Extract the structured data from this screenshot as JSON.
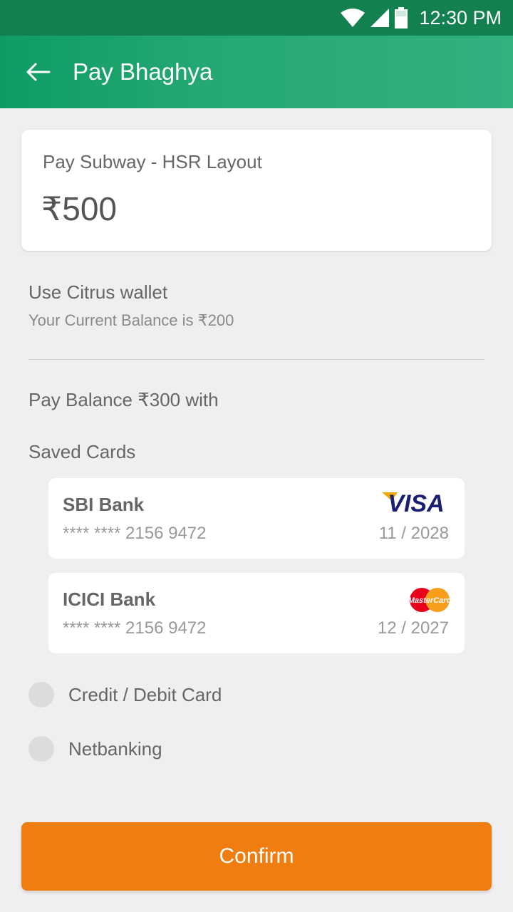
{
  "status_bar": {
    "time": "12:30 PM"
  },
  "app_bar": {
    "title": "Pay Bhaghya"
  },
  "merchant": {
    "name": "Pay Subway - HSR Layout",
    "amount": "₹500"
  },
  "wallet": {
    "title": "Use Citrus wallet",
    "balance_text": "Your Current Balance is ₹200"
  },
  "pay_balance_text": "Pay Balance ₹300 with",
  "saved_cards": {
    "title": "Saved Cards",
    "items": [
      {
        "bank": "SBI Bank",
        "number": "**** **** 2156 9472",
        "expiry": "11 / 2028",
        "brand": "VISA"
      },
      {
        "bank": "ICICI Bank",
        "number": "**** **** 2156 9472",
        "expiry": "12 / 2027",
        "brand": "MasterCard"
      }
    ]
  },
  "options": [
    {
      "label": "Credit / Debit Card",
      "selected": false
    },
    {
      "label": "Netbanking",
      "selected": false
    }
  ],
  "confirm_label": "Confirm",
  "colors": {
    "appbar": "#25a872",
    "status_bar": "#13804f",
    "confirm": "#ef7d0f",
    "background": "#efefef"
  }
}
